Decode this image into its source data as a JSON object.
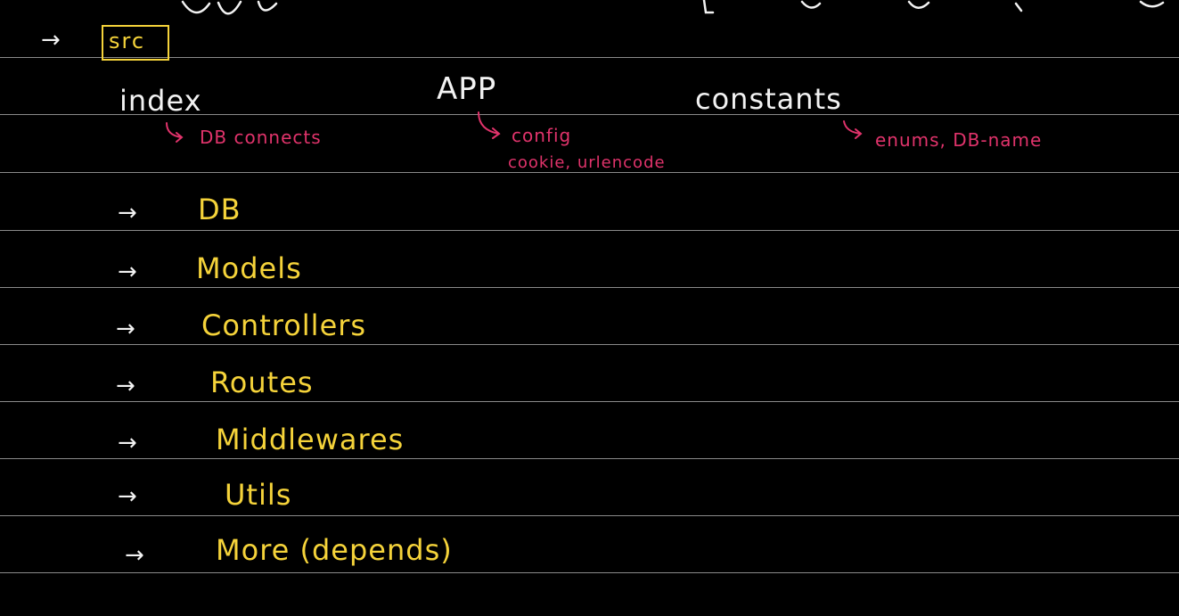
{
  "colors": {
    "background": "#000000",
    "ruled_line": "#8a8a8a",
    "ink_white": "#f2f2f2",
    "ink_yellow": "#f5d33a",
    "ink_pink": "#e0336b"
  },
  "header": {
    "arrow": "→",
    "src_label": "src"
  },
  "top_files": {
    "index": {
      "label": "index",
      "note": "DB connects"
    },
    "app": {
      "label": "APP",
      "note_line1": "config",
      "note_line2": "cookie, urlencode"
    },
    "constants": {
      "label": "constants",
      "note": "enums, DB-name"
    }
  },
  "folders": {
    "arrow": "→",
    "items": [
      "DB",
      "Models",
      "Controllers",
      "Routes",
      "Middlewares",
      "Utils",
      "More (depends)"
    ]
  }
}
